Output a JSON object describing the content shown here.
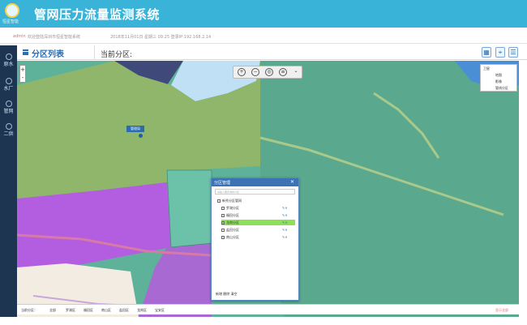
{
  "app": {
    "title": "管网压力流量监测系统",
    "logo_text": "恒星智能"
  },
  "infobar": {
    "user": "admin",
    "welcome": "欢迎登陆深圳市恒星智能系统",
    "login_info": "2018年11月01日 星期三 09:25 登录IP:192.168.2.14"
  },
  "nav": {
    "items": [
      {
        "label": "原水",
        "icon": "water-icon"
      },
      {
        "label": "水厂",
        "icon": "factory-icon"
      },
      {
        "label": "管网",
        "icon": "pipe-icon"
      },
      {
        "label": "二供",
        "icon": "pump-icon"
      }
    ]
  },
  "panel": {
    "title": "分区列表",
    "current_label": "当前分区:"
  },
  "toolbar": {
    "zoom_in": "+",
    "zoom_out": "-"
  },
  "layers": {
    "items": [
      "卫星",
      "地图",
      "影像",
      "管线分区"
    ]
  },
  "pin": {
    "label": "管理局"
  },
  "dialog": {
    "title": "分区管理",
    "search_placeholder": "请输入要查询的分区",
    "root": "新秀分区管网",
    "rows": [
      {
        "label": "罗湖分区",
        "selected": false
      },
      {
        "label": "福田分区",
        "selected": false
      },
      {
        "label": "龙岗分区",
        "selected": true
      },
      {
        "label": "盐田分区",
        "selected": false
      },
      {
        "label": "南山分区",
        "selected": false
      }
    ],
    "footer": "新增 删除 清空"
  },
  "bottombar": {
    "items": [
      "当前分区：",
      "全部",
      "罗湖区",
      "福田区",
      "南山区",
      "盐田区",
      "龙岗区",
      "宝安区"
    ],
    "right": "显示全部"
  },
  "colors": {
    "titlebar": "#3ab3d8",
    "nav": "#1d3550",
    "map_green": "#5fb29a",
    "map_purple": "#b35ee0",
    "map_olive": "#8fb66a",
    "selected_row": "#8ee05a"
  }
}
